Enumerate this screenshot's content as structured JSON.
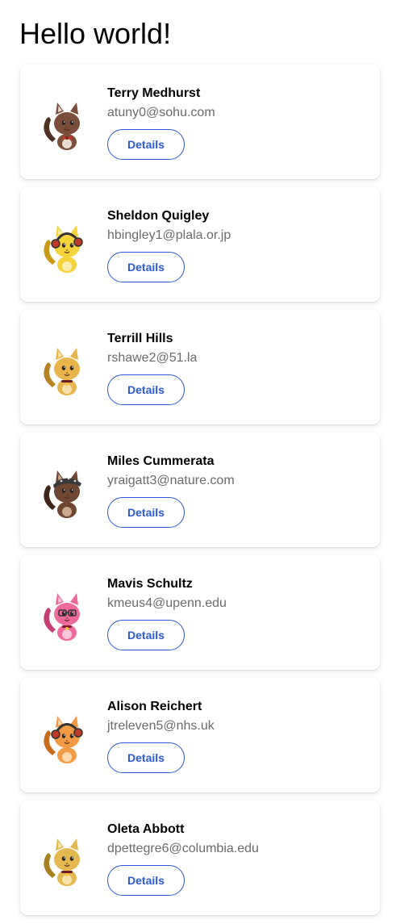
{
  "page": {
    "title": "Hello world!"
  },
  "theme": {
    "accent": "#2d5bd8",
    "secondary_text": "#6b6b6b"
  },
  "users": [
    {
      "name": "Terry Medhurst",
      "email": "atuny0@sohu.com",
      "button_label": "Details",
      "avatar": {
        "icon": "cat-avatar-icon",
        "body": "#7a4e3a",
        "dark": "#4e2f22",
        "belly": "#e9ddd2",
        "accessory": "bow"
      }
    },
    {
      "name": "Sheldon Quigley",
      "email": "hbingley1@plala.or.jp",
      "button_label": "Details",
      "avatar": {
        "icon": "cat-avatar-icon",
        "body": "#f5d33b",
        "dark": "#c99a18",
        "belly": "#fbeeb2",
        "accessory": "headphones"
      }
    },
    {
      "name": "Terrill Hills",
      "email": "rshawe2@51.la",
      "button_label": "Details",
      "avatar": {
        "icon": "cat-avatar-icon",
        "body": "#e7b54c",
        "dark": "#b78425",
        "belly": "#f6e1ad",
        "accessory": "collar"
      }
    },
    {
      "name": "Miles Cummerata",
      "email": "yraigatt3@nature.com",
      "button_label": "Details",
      "avatar": {
        "icon": "cat-avatar-icon",
        "body": "#6e4632",
        "dark": "#3e2619",
        "belly": "#c9a88f",
        "accessory": "bandana"
      }
    },
    {
      "name": "Mavis Schultz",
      "email": "kmeus4@upenn.edu",
      "button_label": "Details",
      "avatar": {
        "icon": "cat-avatar-icon",
        "body": "#ee6a9a",
        "dark": "#c63f74",
        "belly": "#fbc6da",
        "accessory": "glasses"
      }
    },
    {
      "name": "Alison Reichert",
      "email": "jtreleven5@nhs.uk",
      "button_label": "Details",
      "avatar": {
        "icon": "cat-avatar-icon",
        "body": "#f39a45",
        "dark": "#c96c1c",
        "belly": "#ffd9ae",
        "accessory": "headphones"
      }
    },
    {
      "name": "Oleta Abbott",
      "email": "dpettegre6@columbia.edu",
      "button_label": "Details",
      "avatar": {
        "icon": "cat-avatar-icon",
        "body": "#e3b94f",
        "dark": "#a8801f",
        "belly": "#f7e4ad",
        "accessory": "collar"
      }
    }
  ]
}
